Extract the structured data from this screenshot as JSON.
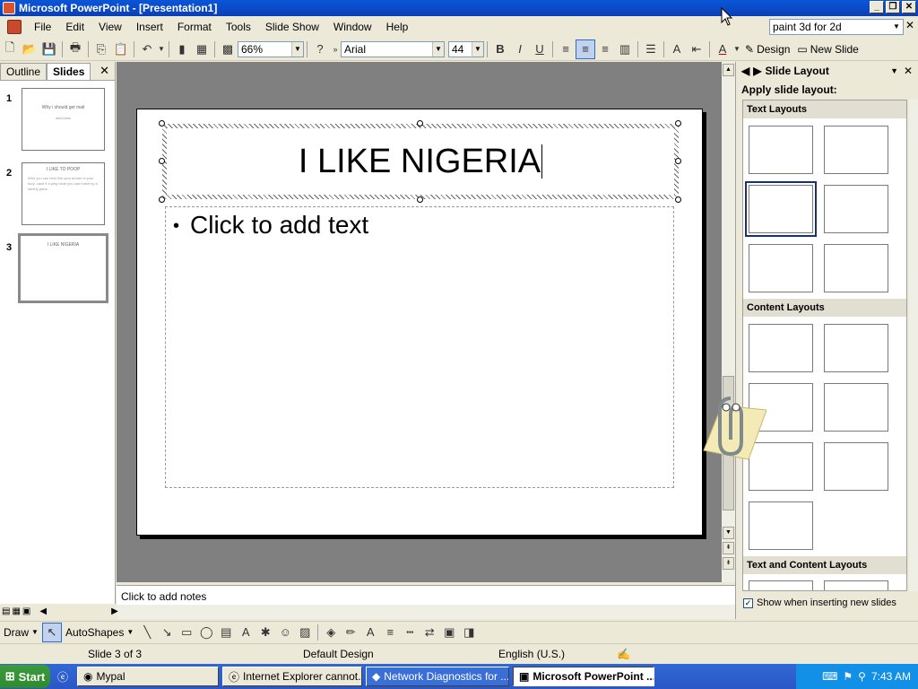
{
  "window": {
    "title": "Microsoft PowerPoint - [Presentation1]"
  },
  "menu": {
    "items": [
      "File",
      "Edit",
      "View",
      "Insert",
      "Format",
      "Tools",
      "Slide Show",
      "Window",
      "Help"
    ],
    "help_value": "paint 3d for 2d"
  },
  "toolbar": {
    "zoom": "66%",
    "font": "Arial",
    "size": "44",
    "design_label": "Design",
    "new_slide_label": "New Slide"
  },
  "outline_tabs": {
    "outline": "Outline",
    "slides": "Slides"
  },
  "thumbnails": [
    {
      "num": "1",
      "title": "Why i should get mail",
      "body": "aint2clam"
    },
    {
      "num": "2",
      "title": "I LIKE TO POOP",
      "body": "Wim you can next line your anmer in your bury. cault if a pray cloth you can make by a steerly pane."
    },
    {
      "num": "3",
      "title": "I LIKE NIGERIA",
      "body": ""
    }
  ],
  "slide": {
    "title": "I LIKE NIGERIA",
    "body_placeholder": "Click to add text",
    "bullet": "•"
  },
  "notes_placeholder": "Click to add notes",
  "taskpane": {
    "title": "Slide Layout",
    "apply_label": "Apply slide layout:",
    "sections": [
      "Text Layouts",
      "Content Layouts",
      "Text and Content Layouts"
    ],
    "show_label": "Show when inserting new slides",
    "show_checked": true
  },
  "drawbar": {
    "draw": "Draw",
    "autoshapes": "AutoShapes"
  },
  "status": {
    "slide": "Slide 3 of 3",
    "design": "Default Design",
    "language": "English (U.S.)"
  },
  "taskbar": {
    "start": "Start",
    "items": [
      "Mypal",
      "Internet Explorer cannot...",
      "Network Diagnostics for ...",
      "Microsoft PowerPoint ..."
    ],
    "time": "7:43 AM"
  }
}
